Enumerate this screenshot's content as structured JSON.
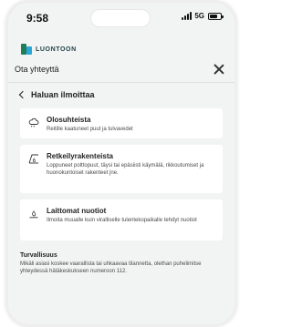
{
  "status_bar": {
    "time": "9:58",
    "network": "5G",
    "battery_level": 0.7
  },
  "brand": {
    "logo_text": "LUONTOON",
    "colors": {
      "green": "#1e7e5a",
      "blue": "#2aa6d8"
    }
  },
  "header": {
    "title": "Ota yhteyttä",
    "close_icon": "close-icon"
  },
  "nav": {
    "back_label": "Haluan ilmoittaa",
    "back_icon": "chevron-left-icon"
  },
  "options": [
    {
      "icon": "weather-icon",
      "title": "Olosuhteista",
      "description": "Reitille kaatuneet puut ja tulvavedet"
    },
    {
      "icon": "campfire-icon",
      "title": "Retkeilyrakenteista",
      "description": "Loppuneet polttopuut, täysi tai epäsiisti käymälä, rikkoutumiset ja huonokuntoiset rakenteet jne."
    },
    {
      "icon": "fire-icon",
      "title": "Laittomat nuotiot",
      "description": "Ilmoita muualle kuin viralliselle tulentekopaikalle tehdyt nuotiot"
    }
  ],
  "safety": {
    "title": "Turvallisuus",
    "text": "Mikäli asiasi koskee vaarallista tai uhkaavaa tilannetta, olethan puhelimitse yhteydessä hätäkeskukseen numeroon 112."
  }
}
